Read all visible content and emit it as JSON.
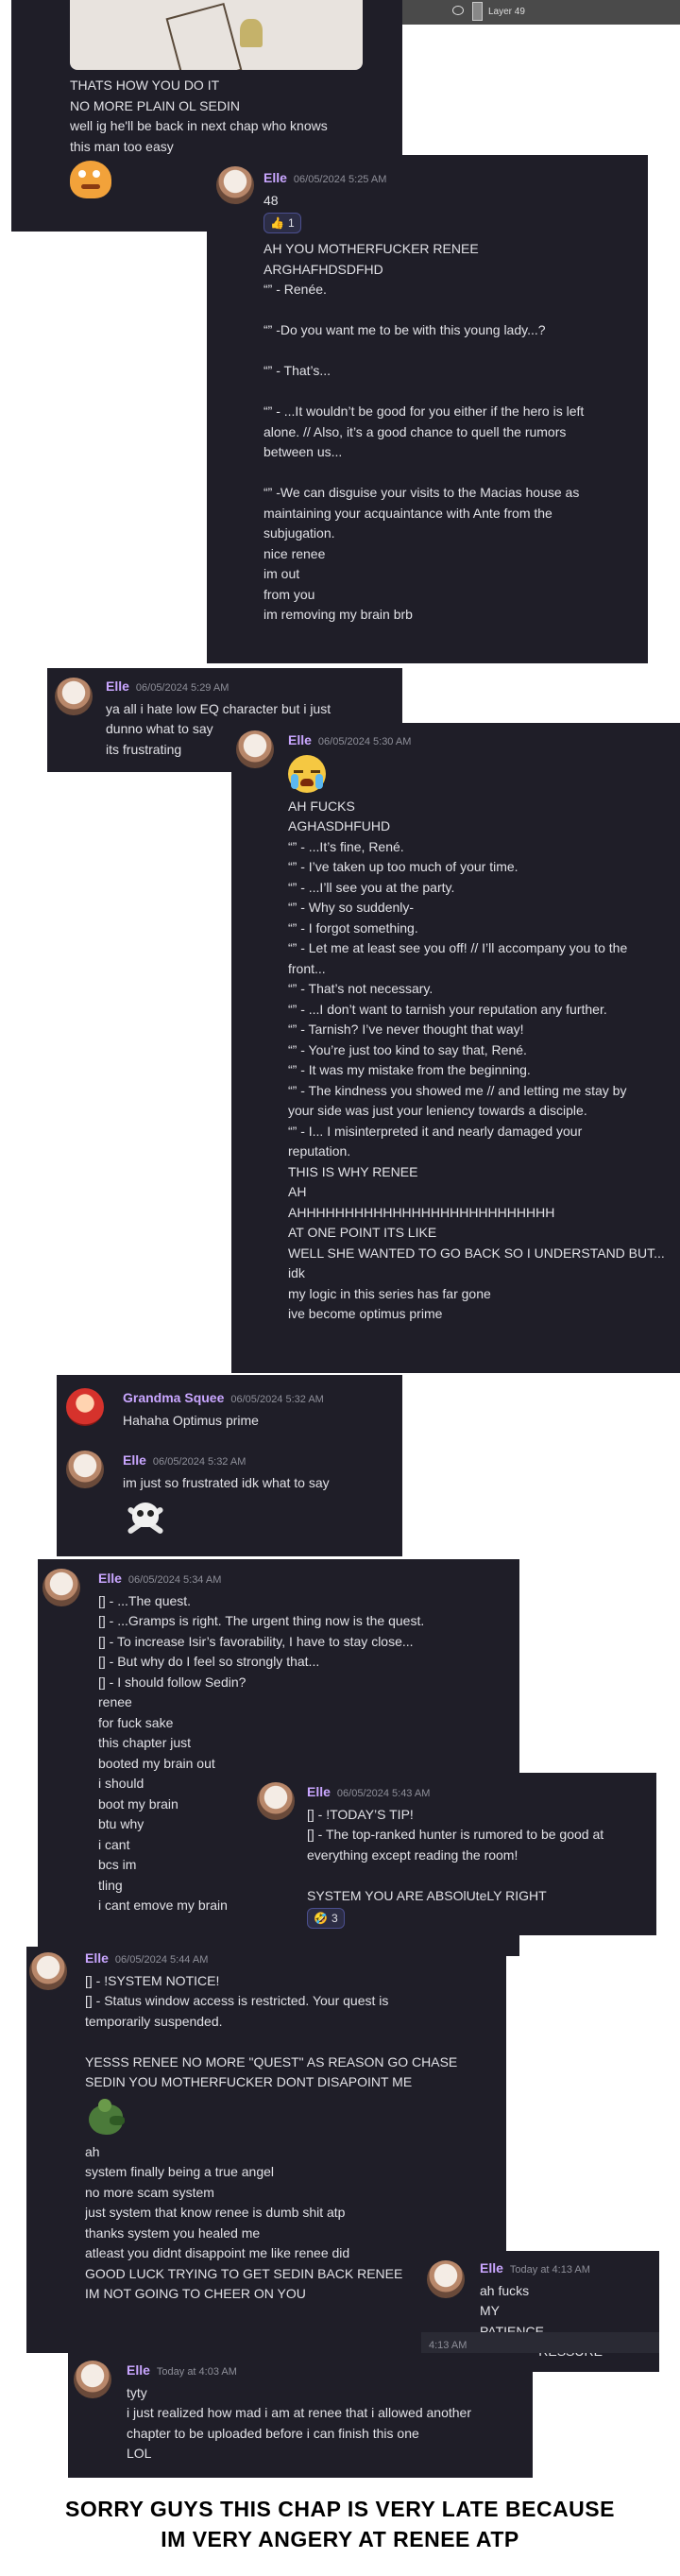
{
  "p1": {
    "lines": [
      "THATS HOW YOU DO IT",
      "NO MORE PLAIN OL SEDIN",
      "well ig he'll be back in next chap who knows",
      "this man too easy"
    ]
  },
  "ps": {
    "layer_label": "Layer 49"
  },
  "p2": {
    "name": "Elle",
    "time": "06/05/2024 5:25 AM",
    "first": "48",
    "reaction": {
      "emoji": "👍",
      "count": "1"
    },
    "lines": [
      "AH YOU MOTHERFUCKER RENEE",
      "ARGHAFHDSDFHD",
      "“” - Renée.",
      "",
      "“” -Do you want me to be with this young lady...?",
      "",
      "“” - That’s...",
      "",
      "“” - ...It wouldn’t be good for you either if the hero is left",
      "alone. // Also, it’s a good chance to quell the rumors",
      "between us...",
      "",
      "“” -We can disguise your visits to the Macias house as",
      "maintaining your acquaintance with Ante from the",
      "subjugation.",
      "nice renee",
      "im out",
      "from you",
      "im removing my brain brb"
    ]
  },
  "p3": {
    "name": "Elle",
    "time": "06/05/2024 5:29 AM",
    "lines": [
      "ya all i hate low EQ character but i just",
      "dunno what to say",
      "its frustrating"
    ]
  },
  "p4": {
    "name": "Elle",
    "time": "06/05/2024 5:30 AM",
    "lines": [
      "AH FUCKS",
      "AGHASDHFUHD",
      "“” - ...It’s fine, René.",
      "“” - I’ve taken up too much of your time.",
      "“” - ...I’ll see you at the party.",
      "“” - Why so suddenly-",
      "“” - I forgot something.",
      "“” - Let me at least see you off! // I’ll accompany you to the",
      "front...",
      "“” - That’s not necessary.",
      "“” - ...I don’t want to tarnish your reputation any further.",
      "“” - Tarnish? I’ve never thought that way!",
      "“” - You’re just too kind to say that, René.",
      "“” - It was my mistake from the beginning.",
      "“” - The kindness you showed me // and letting me stay by",
      "your side was just your leniency towards a disciple.",
      "“” - I... I misinterpreted it and nearly damaged your",
      "reputation.",
      "THIS IS WHY RENEE",
      "AH",
      "AHHHHHHHHHHHHHHHHHHHHHHHHHHH",
      "AT ONE POINT ITS LIKE",
      "WELL SHE WANTED TO GO BACK SO I UNDERSTAND BUT...",
      "idk",
      "my logic in this series has far gone",
      "ive become optimus prime"
    ]
  },
  "p5": {
    "m1": {
      "name": "Grandma Squee",
      "time": "06/05/2024 5:32 AM",
      "text": "Hahaha Optimus prime"
    },
    "m2": {
      "name": "Elle",
      "time": "06/05/2024 5:32 AM",
      "text": "im just so frustrated idk what to say"
    }
  },
  "p6": {
    "name": "Elle",
    "time": "06/05/2024 5:34 AM",
    "lines": [
      "[] - ...The quest.",
      "[] - ...Gramps is right. The urgent thing now is the quest.",
      "[] - To increase Isir’s favorability, I have to stay close...",
      "[] - But why do I feel so strongly that...",
      "[] - I should follow Sedin?",
      "renee",
      "for fuck sake",
      "this chapter just",
      "booted my brain out",
      "i should",
      "boot my brain",
      "btu why",
      "i cant",
      "bcs im",
      "tling",
      "i cant emove my brain"
    ]
  },
  "p7": {
    "name": "Elle",
    "time": "06/05/2024 5:43 AM",
    "lines": [
      "[] - !TODAY’S TIP!",
      "[] - The top-ranked hunter is rumored to be good at",
      "everything except reading the room!",
      "",
      "SYSTEM YOU ARE ABSOlUteLY RIGHT"
    ],
    "reaction": {
      "emoji": "🤣",
      "count": "3"
    }
  },
  "p8": {
    "name": "Elle",
    "time": "06/05/2024 5:44 AM",
    "lines_a": [
      "[] - !SYSTEM NOTICE!",
      "[] - Status window access is restricted. Your quest is",
      "temporarily suspended.",
      "",
      "YESSS RENEE NO MORE \"QUEST\" AS REASON GO CHASE",
      "SEDIN YOU MOTHERFUCKER DONT DISAPOINT ME"
    ],
    "lines_b": [
      "ah",
      "system finally being a true angel",
      "no more scam system",
      "just system that know renee is dumb shit atp",
      "thanks system you healed me",
      "atleast you didnt disappoint me like renee did",
      "GOOD LUCK TRYING TO GET SEDIN BACK RENEE",
      "IM NOT GOING TO CHEER ON YOU"
    ]
  },
  "p9": {
    "name": "Elle",
    "time": "Today at 4:13 AM",
    "side_time": "4:13 AM",
    "lines": [
      "ah fucks",
      "MY",
      "PATIENCE",
      "BLOOD PRESSURE"
    ]
  },
  "p10": {
    "name": "Elle",
    "time": "Today at 4:03 AM",
    "lines": [
      "tyty",
      "i just realized how mad i am at renee that i allowed another",
      "chapter to be uploaded before i can finish this one",
      "LOL"
    ]
  },
  "caption": {
    "line1": "SORRY GUYS THIS CHAP IS VERY LATE BECAUSE",
    "line2": "IM VERY ANGERY AT RENEE ATP"
  }
}
